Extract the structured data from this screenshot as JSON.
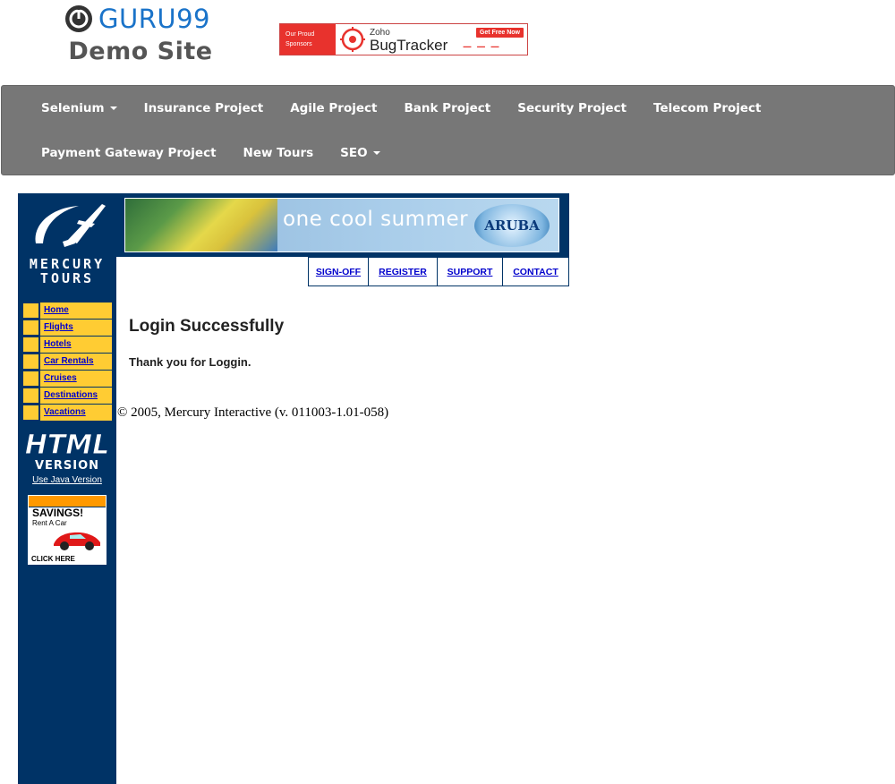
{
  "header": {
    "logo_word": "GURU99",
    "logo_sub": "Demo Site",
    "sponsor": {
      "left_line1": "Our Proud",
      "left_line2": "Sponsors",
      "brand_small": "Zoho",
      "brand_big": "BugTracker",
      "cta": "Get Free Now"
    }
  },
  "navbar": {
    "row1": [
      {
        "label": "Selenium",
        "dropdown": true
      },
      {
        "label": "Insurance Project",
        "dropdown": false
      },
      {
        "label": "Agile Project",
        "dropdown": false
      },
      {
        "label": "Bank Project",
        "dropdown": false
      },
      {
        "label": "Security Project",
        "dropdown": false
      },
      {
        "label": "Telecom Project",
        "dropdown": false
      }
    ],
    "row2": [
      {
        "label": "Payment Gateway Project",
        "dropdown": false
      },
      {
        "label": "New Tours",
        "dropdown": false
      },
      {
        "label": "SEO",
        "dropdown": true
      }
    ]
  },
  "mercury": {
    "logo_word": "MERCURY TOURS",
    "banner_text": "one cool summer",
    "banner_logo": "ARUBA",
    "top_links": [
      "SIGN-OFF",
      "REGISTER",
      "SUPPORT",
      "CONTACT"
    ],
    "side_links": [
      "Home",
      "Flights",
      "Hotels",
      "Car Rentals",
      "Cruises",
      "Destinations",
      "Vacations"
    ],
    "html_badge": "HTML VERSION",
    "java_link": "Use Java Version",
    "savings": {
      "title": "SAVINGS!",
      "sub": "Rent A Car",
      "click": "CLICK HERE"
    }
  },
  "main": {
    "title": "Login Successfully",
    "message": "Thank you for Loggin.",
    "footer": "© 2005, Mercury Interactive (v. 011003-1.01-058)"
  },
  "colors": {
    "navbar_bg": "#777777",
    "mercury_blue": "#003366",
    "menu_yellow": "#ffcc33",
    "link_blue": "#0000cc",
    "guru_blue": "#1a73c9"
  }
}
